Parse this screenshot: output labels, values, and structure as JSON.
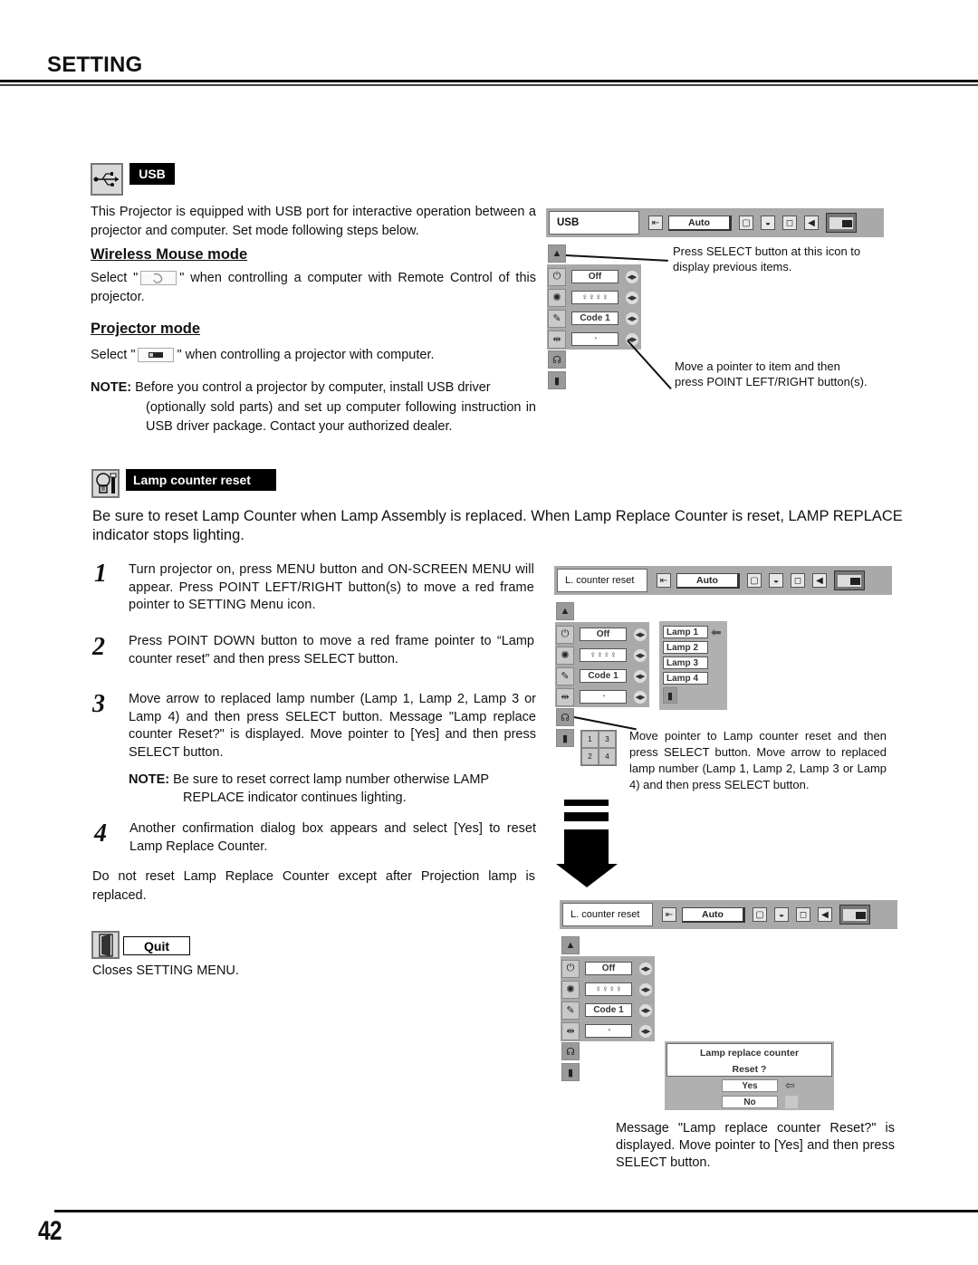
{
  "header": {
    "title": "SETTING",
    "page_number": "42"
  },
  "usb_section": {
    "icon": "usb-icon",
    "badge": "USB",
    "intro": "This Projector is equipped with USB port for interactive operation between a projector and computer. Set mode following steps below.",
    "wireless": {
      "heading": "Wireless Mouse mode",
      "text_before": "Select \"",
      "text_after": "\" when controlling a computer with Remote Control of this projector.",
      "inline_icon": "mouse-icon"
    },
    "projector": {
      "heading": "Projector mode",
      "text_before": "Select \"",
      "text_after": "\" when controlling a projector with computer.",
      "inline_icon": "projector-icon"
    },
    "note_label": "NOTE:",
    "note_line1": "Before you control a projector by computer, install USB driver",
    "note_rest": "(optionally sold parts) and set up computer following instruction in USB driver package. Contact your authorized dealer.",
    "osd": {
      "title": "USB",
      "auto": "Auto",
      "rows": [
        {
          "icon": "power-icon",
          "value": "Off"
        },
        {
          "icon": "lamp-mode-icon",
          "value": "ꝏꝏ"
        },
        {
          "icon": "remote-code-icon",
          "value": "Code 1"
        },
        {
          "icon": "usb-icon",
          "value": ""
        }
      ]
    },
    "callout_top": "Press SELECT button at this icon to display previous items.",
    "callout_bottom": "Move a pointer to item and then press POINT LEFT/RIGHT button(s)."
  },
  "lamp_section": {
    "icon": "lamp-reset-icon",
    "badge": "Lamp counter reset",
    "intro": "Be sure to reset Lamp Counter when Lamp Assembly is replaced.  When Lamp Replace Counter is reset, LAMP REPLACE indicator stops lighting.",
    "steps": [
      {
        "num": "1",
        "text": "Turn projector on, press MENU button and ON-SCREEN MENU will appear.  Press POINT LEFT/RIGHT button(s) to move a red frame pointer to SETTING Menu icon."
      },
      {
        "num": "2",
        "text": "Press POINT DOWN button to move a red frame pointer to “Lamp counter reset” and then press SELECT button."
      },
      {
        "num": "3",
        "text": "Move arrow to replaced lamp number (Lamp 1, Lamp 2, Lamp 3 or Lamp 4) and then press SELECT button.  Message \"Lamp replace counter Reset?\" is displayed. Move pointer to [Yes] and then press SELECT button."
      },
      {
        "num": "4",
        "text": "Another confirmation dialog box appears and select [Yes] to reset Lamp Replace Counter."
      }
    ],
    "note_label": "NOTE:",
    "note_line1": "Be sure to reset correct lamp number otherwise LAMP",
    "note_rest": "REPLACE indicator continues lighting.",
    "warning": "Do not reset Lamp Replace Counter except after Projection lamp is replaced.",
    "osd1": {
      "title": "L. counter reset",
      "auto": "Auto",
      "rows": [
        {
          "icon": "power-icon",
          "value": "Off"
        },
        {
          "icon": "lamp-mode-icon",
          "value": "ꝏꝏ"
        },
        {
          "icon": "remote-code-icon",
          "value": "Code 1"
        },
        {
          "icon": "usb-icon",
          "value": ""
        }
      ],
      "lamps": [
        "Lamp 1",
        "Lamp 2",
        "Lamp 3",
        "Lamp 4"
      ],
      "selected_lamp": "Lamp 1"
    },
    "lamp_grid": [
      "1",
      "3",
      "2",
      "4"
    ],
    "callout_osd1": "Move pointer to Lamp counter reset and then press SELECT button.  Move arrow to replaced lamp number (Lamp 1, Lamp 2, Lamp 3 or Lamp 4) and then press SELECT button.",
    "osd2": {
      "title": "L. counter reset",
      "auto": "Auto",
      "rows": [
        {
          "icon": "power-icon",
          "value": "Off"
        },
        {
          "icon": "lamp-mode-icon",
          "value": "ꝏꝏ"
        },
        {
          "icon": "remote-code-icon",
          "value": "Code 1"
        },
        {
          "icon": "usb-icon",
          "value": ""
        }
      ],
      "dialog_line1": "Lamp replace counter",
      "dialog_line2": "Reset ?",
      "yes": "Yes",
      "no": "No"
    },
    "callout_osd2": "Message \"Lamp replace counter Reset?\" is displayed. Move pointer to [Yes] and then press SELECT button."
  },
  "quit_section": {
    "icon": "door-icon",
    "badge": "Quit",
    "text": "Closes SETTING MENU."
  }
}
